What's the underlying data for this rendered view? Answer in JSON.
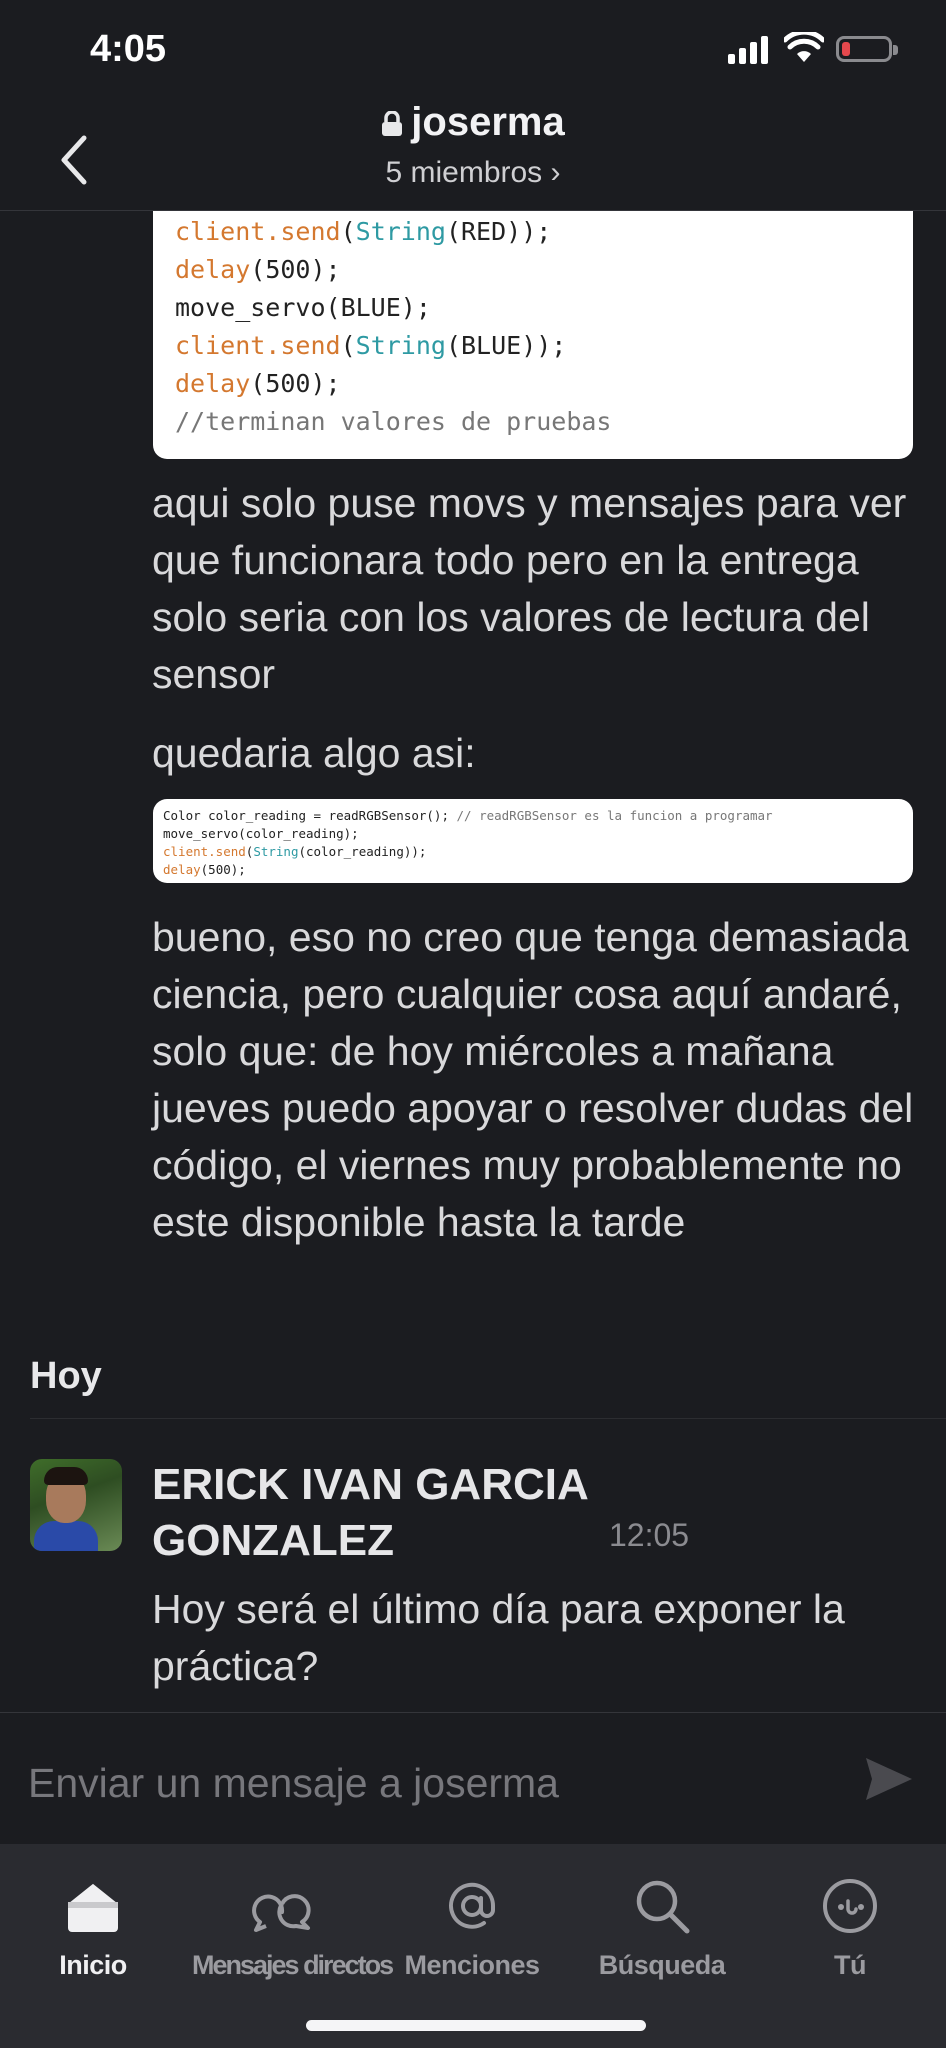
{
  "status": {
    "time": "4:05"
  },
  "header": {
    "channel": "joserma",
    "members": "5 miembros ›"
  },
  "code_snippet_1": [
    [
      [
        "client.send",
        "orange"
      ],
      [
        "(",
        "plain"
      ],
      [
        "String",
        "teal"
      ],
      [
        "(RED));",
        "plain"
      ]
    ],
    [
      [
        "delay",
        "orange"
      ],
      [
        "(500);",
        "plain"
      ]
    ],
    [
      [
        "move_servo(BLUE);",
        "plain"
      ]
    ],
    [
      [
        "client.send",
        "orange"
      ],
      [
        "(",
        "plain"
      ],
      [
        "String",
        "teal"
      ],
      [
        "(BLUE));",
        "plain"
      ]
    ],
    [
      [
        "delay",
        "orange"
      ],
      [
        "(500);",
        "plain"
      ]
    ],
    [
      [
        "//terminan valores de pruebas",
        "comment"
      ]
    ]
  ],
  "messages": {
    "m1": "aqui solo puse movs y mensajes para ver que funcionara todo pero en la entrega solo seria con los valores de lectura del sensor",
    "m2": "quedaria algo asi:",
    "m3": "bueno, eso no creo que tenga demasiada ciencia, pero cualquier cosa aquí andaré, solo que: de hoy miércoles a mañana jueves puedo apoyar o resolver dudas del código, el viernes muy probablemente no este disponible hasta la tarde",
    "m4": "Hoy será el último día para exponer la práctica?"
  },
  "code_snippet_2": [
    [
      [
        "Color color_reading = readRGBSensor(); ",
        "plain"
      ],
      [
        "// readRGBSensor es la funcion a programar",
        "comment"
      ]
    ],
    [
      [
        "move_servo(color_reading);",
        "plain"
      ]
    ],
    [
      [
        "client.send",
        "orange"
      ],
      [
        "(",
        "plain"
      ],
      [
        "String",
        "teal"
      ],
      [
        "(color_reading));",
        "plain"
      ]
    ],
    [
      [
        "delay",
        "orange"
      ],
      [
        "(500);",
        "plain"
      ]
    ]
  ],
  "day_label": "Hoy",
  "latest": {
    "sender": "ERICK IVAN GARCIA GONZALEZ",
    "time": "12:05"
  },
  "composer": {
    "placeholder": "Enviar un mensaje a joserma"
  },
  "tabs": [
    {
      "label": "Inicio",
      "icon": "home-icon",
      "active": true
    },
    {
      "label": "Mensajes directos",
      "icon": "direct-messages-icon",
      "active": false
    },
    {
      "label": "Menciones",
      "icon": "at-mention-icon",
      "active": false
    },
    {
      "label": "Búsqueda",
      "icon": "search-icon",
      "active": false
    },
    {
      "label": "Tú",
      "icon": "profile-icon",
      "active": false
    }
  ]
}
